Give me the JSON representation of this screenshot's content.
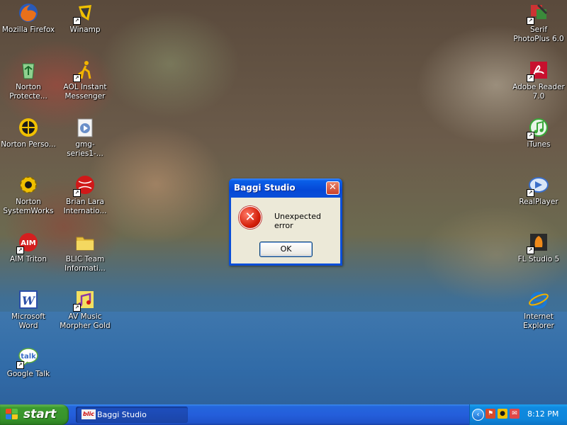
{
  "desktop": {
    "icons": [
      {
        "label": "Mozilla Firefox",
        "icon": "firefox-icon",
        "color": "#e8701a"
      },
      {
        "label": "Winamp",
        "icon": "winamp-icon",
        "color": "#3a3a3a"
      },
      {
        "label": "Serif PhotoPlus 6.0",
        "icon": "serif-photoplus-icon",
        "color": "#cc3333"
      },
      {
        "label": "Norton Protecte...",
        "icon": "norton-protected-recycle-bin-icon",
        "color": "#2f9a3a"
      },
      {
        "label": "AOL Instant Messenger",
        "icon": "aim-running-man-icon",
        "color": "#f2b400"
      },
      {
        "label": "Adobe Reader 7.0",
        "icon": "adobe-reader-icon",
        "color": "#c8102e"
      },
      {
        "label": "Norton Perso...",
        "icon": "norton-personal-firewall-icon",
        "color": "#f0c000"
      },
      {
        "label": "gmg-series1-...",
        "icon": "media-file-icon",
        "color": "#6a8fc8"
      },
      {
        "label": "iTunes",
        "icon": "itunes-icon",
        "color": "#38a838"
      },
      {
        "label": "Norton SystemWorks",
        "icon": "norton-systemworks-icon",
        "color": "#f0c000"
      },
      {
        "label": "Brian Lara Internatio...",
        "icon": "brian-lara-cricket-icon",
        "color": "#d01818"
      },
      {
        "label": "RealPlayer",
        "icon": "realplayer-icon",
        "color": "#3a6ec8"
      },
      {
        "label": "AIM Triton",
        "icon": "aim-triton-icon",
        "color": "#d41f1f"
      },
      {
        "label": "BLIC Team Informati...",
        "icon": "folder-icon",
        "color": "#e8c040"
      },
      {
        "label": "FL Studio 5",
        "icon": "fl-studio-icon",
        "color": "#f08a1a"
      },
      {
        "label": "Microsoft Word",
        "icon": "microsoft-word-icon",
        "color": "#2b4fa8"
      },
      {
        "label": "AV Music Morpher Gold",
        "icon": "av-music-morpher-icon",
        "color": "#8a3aa8"
      },
      {
        "label": "Internet Explorer",
        "icon": "internet-explorer-icon",
        "color": "#1a7ad8"
      },
      {
        "label": "Google Talk",
        "icon": "google-talk-icon",
        "color": "#5aaa3a"
      }
    ]
  },
  "dialog": {
    "title": "Baggi Studio",
    "message": "Unexpected error",
    "ok_label": "OK",
    "close_glyph": "✕",
    "error_glyph": "✕"
  },
  "taskbar": {
    "start_label": "start",
    "task_icon_text": "blic",
    "task_label": "Baggi Studio",
    "clock": "8:12 PM"
  },
  "colors": {
    "taskbar_blue": "#245edb",
    "start_green": "#37932b",
    "tray_blue": "#0e86db",
    "dialog_title_blue": "#0548d6",
    "dialog_body": "#ece9d8"
  }
}
